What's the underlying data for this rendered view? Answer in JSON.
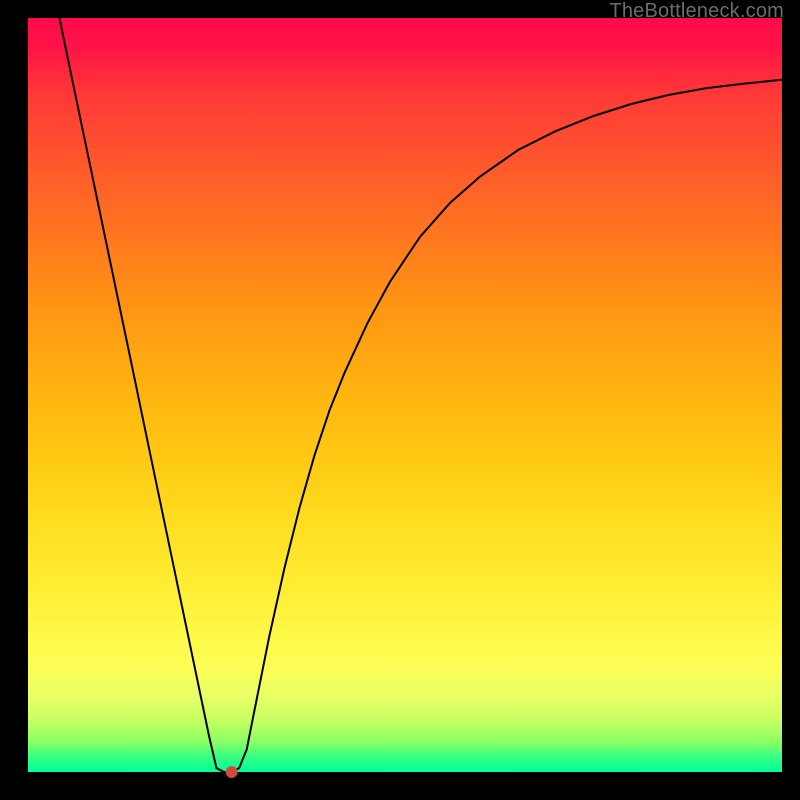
{
  "watermark": "TheBottleneck.com",
  "chart_data": {
    "type": "line",
    "title": "",
    "xlabel": "",
    "ylabel": "",
    "xlim": [
      0,
      100
    ],
    "ylim": [
      0,
      100
    ],
    "x": [
      0,
      2,
      4,
      6,
      8,
      10,
      12,
      14,
      16,
      18,
      20,
      22,
      24,
      25,
      26,
      27,
      28,
      29,
      30,
      32,
      34,
      36,
      38,
      40,
      42,
      45,
      48,
      52,
      56,
      60,
      65,
      70,
      75,
      80,
      85,
      90,
      95,
      100
    ],
    "values": [
      120,
      110.4,
      100.8,
      91.2,
      81.6,
      72.0,
      62.4,
      52.8,
      43.2,
      33.6,
      24.0,
      14.4,
      4.8,
      0.5,
      0.0,
      0.0,
      0.5,
      3.0,
      8.0,
      18.0,
      27.0,
      35.0,
      42.0,
      48.0,
      53.0,
      59.5,
      65.0,
      71.0,
      75.5,
      79.0,
      82.5,
      85.0,
      87.0,
      88.6,
      89.8,
      90.7,
      91.3,
      91.8
    ],
    "marker": {
      "x": 27,
      "y": 0
    },
    "background_gradient": [
      "#ff0a4a",
      "#ff3838",
      "#ff7a1e",
      "#ffb010",
      "#ffe022",
      "#fcff56",
      "#8aff64",
      "#00ff9a"
    ]
  }
}
